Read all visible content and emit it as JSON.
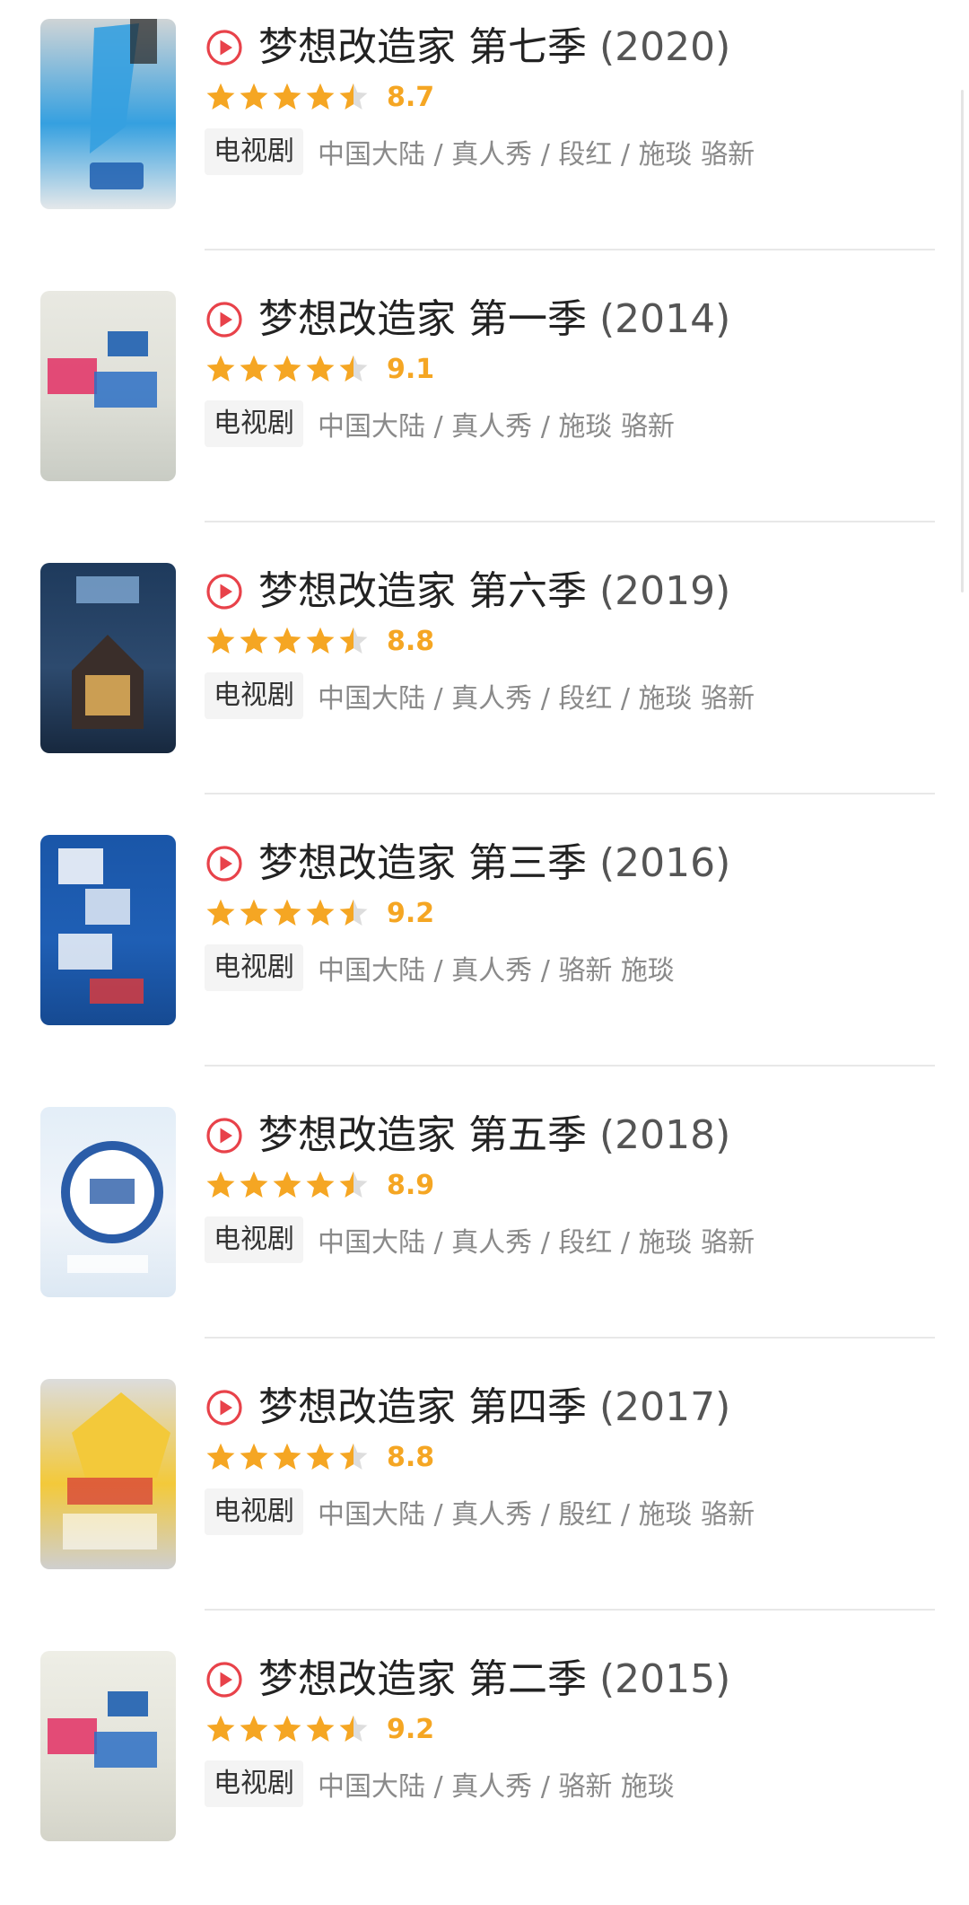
{
  "shows": [
    {
      "title": "梦想改造家 第七季",
      "year": "(2020)",
      "rating": 4.5,
      "score": "8.7",
      "type": "电视剧",
      "meta": "中国大陆 / 真人秀 / 段红 / 施琰 骆新",
      "poster_colors": {
        "top": "#cfd4d6",
        "mid": "#35a0e0",
        "bottom": "#e5e8ea",
        "accent": "#1e5fb0"
      }
    },
    {
      "title": "梦想改造家 第一季",
      "year": "(2014)",
      "rating": 4.5,
      "score": "9.1",
      "type": "电视剧",
      "meta": "中国大陆 / 真人秀 / 施琰 骆新",
      "poster_colors": {
        "top": "#e9e9e2",
        "mid": "#dfe0d8",
        "bottom": "#c9ccc4",
        "accent": "#e23a6a"
      }
    },
    {
      "title": "梦想改造家 第六季",
      "year": "(2019)",
      "rating": 4.5,
      "score": "8.8",
      "type": "电视剧",
      "meta": "中国大陆 / 真人秀 / 段红 / 施琰 骆新",
      "poster_colors": {
        "top": "#1e3a5c",
        "mid": "#2d4a6e",
        "bottom": "#17283e",
        "accent": "#e5b25a"
      }
    },
    {
      "title": "梦想改造家 第三季",
      "year": "(2016)",
      "rating": 4.5,
      "score": "9.2",
      "type": "电视剧",
      "meta": "中国大陆 / 真人秀 / 骆新 施琰",
      "poster_colors": {
        "top": "#1a56a8",
        "mid": "#1f5fb5",
        "bottom": "#164a92",
        "accent": "#ffffff"
      }
    },
    {
      "title": "梦想改造家 第五季",
      "year": "(2018)",
      "rating": 4.5,
      "score": "8.9",
      "type": "电视剧",
      "meta": "中国大陆 / 真人秀 / 段红 / 施琰 骆新",
      "poster_colors": {
        "top": "#e3eef8",
        "mid": "#f1f5fa",
        "bottom": "#dce8f3",
        "accent": "#2a5ca8"
      }
    },
    {
      "title": "梦想改造家 第四季",
      "year": "(2017)",
      "rating": 4.5,
      "score": "8.8",
      "type": "电视剧",
      "meta": "中国大陆 / 真人秀 / 殷红 / 施琰 骆新",
      "poster_colors": {
        "top": "#dcdcdc",
        "mid": "#f3c93a",
        "bottom": "#cfcfcf",
        "accent": "#d8453a"
      }
    },
    {
      "title": "梦想改造家 第二季",
      "year": "(2015)",
      "rating": 4.5,
      "score": "9.2",
      "type": "电视剧",
      "meta": "中国大陆 / 真人秀 / 骆新 施琰",
      "poster_colors": {
        "top": "#eeeee6",
        "mid": "#e4e4da",
        "bottom": "#d4d4c9",
        "accent": "#e23a6a"
      }
    }
  ],
  "colors": {
    "play_icon": "#e8424a",
    "star_filled": "#f5a623",
    "star_empty": "#dddddd"
  },
  "icons": {
    "play": "play-circle-icon",
    "star": "star-icon",
    "half_star": "half-star-icon"
  }
}
